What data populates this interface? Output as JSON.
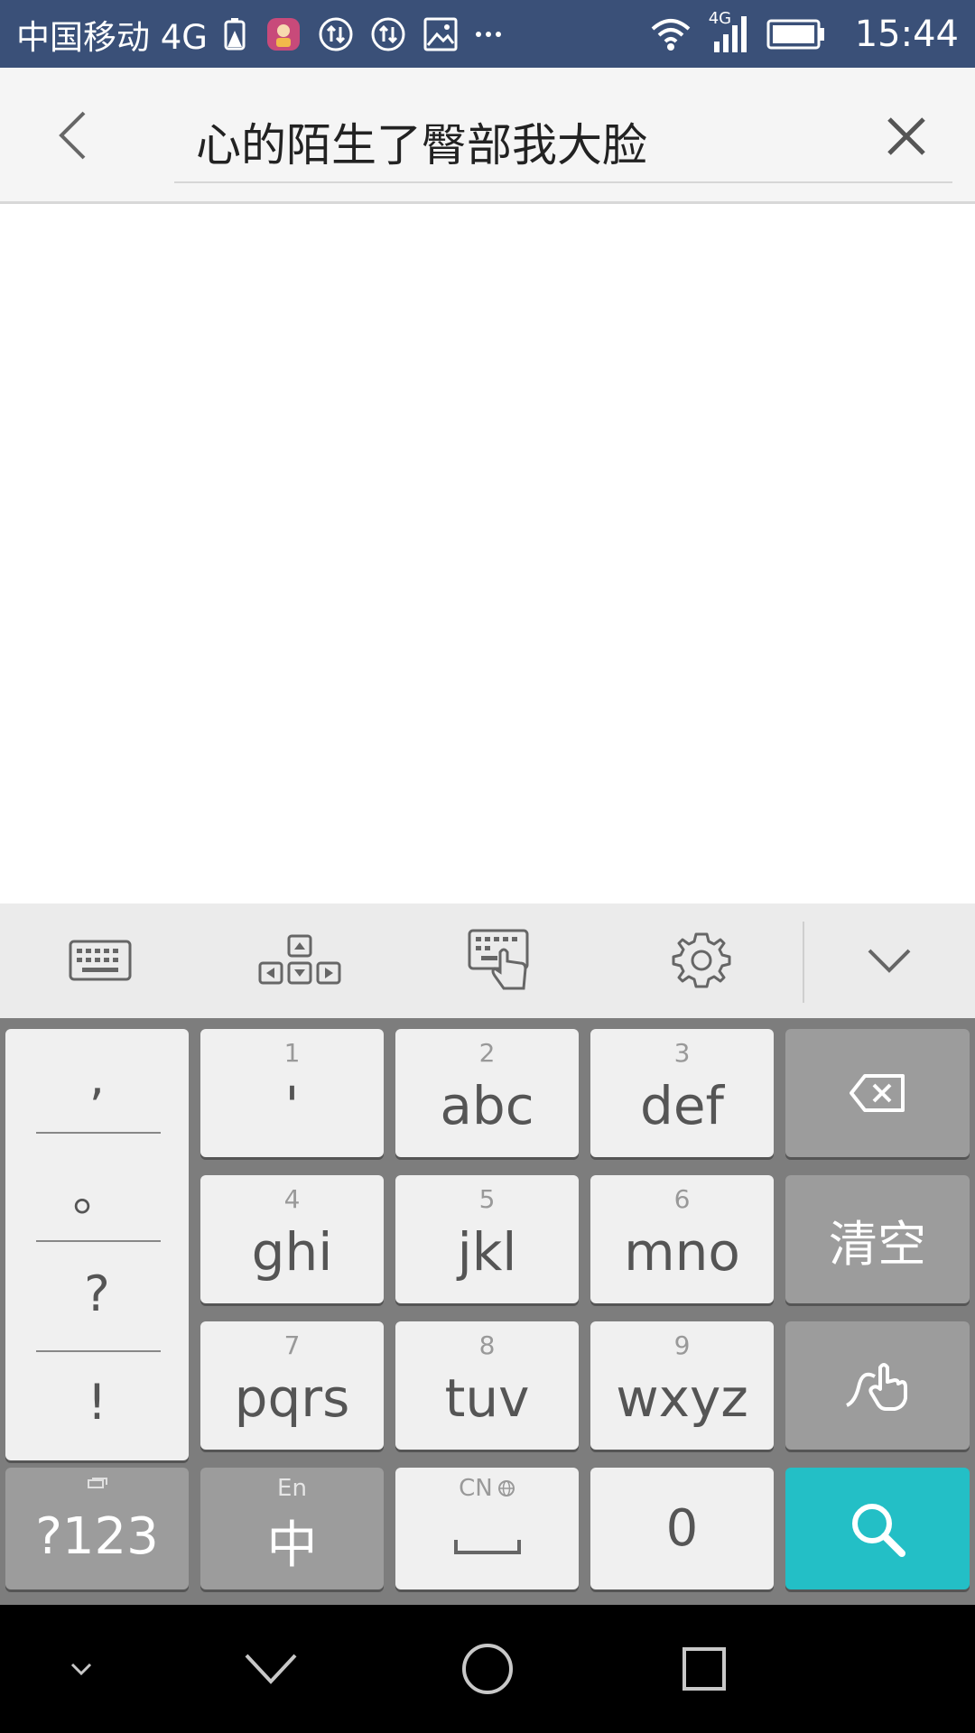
{
  "status_bar": {
    "carrier": "中国移动 4G",
    "network_label": "4G",
    "time": "15:44"
  },
  "search": {
    "query": "心的陌生了臀部我大脸"
  },
  "keyboard": {
    "punctuation": [
      ",",
      "。",
      "?",
      "!"
    ],
    "keys": [
      {
        "num": "1",
        "label": "'"
      },
      {
        "num": "2",
        "label": "abc"
      },
      {
        "num": "3",
        "label": "def"
      },
      {
        "num": "4",
        "label": "ghi"
      },
      {
        "num": "5",
        "label": "jkl"
      },
      {
        "num": "6",
        "label": "mno"
      },
      {
        "num": "7",
        "label": "pqrs"
      },
      {
        "num": "8",
        "label": "tuv"
      },
      {
        "num": "9",
        "label": "wxyz"
      }
    ],
    "clear_label": "清空",
    "symbols_label": "?123",
    "lang_top": "En",
    "lang_main": "中",
    "space_top": "CN",
    "zero_label": "0"
  },
  "colors": {
    "status_bar": "#3a5078",
    "search_key": "#23bfc6",
    "keyboard_bg": "#7d7d7d"
  }
}
